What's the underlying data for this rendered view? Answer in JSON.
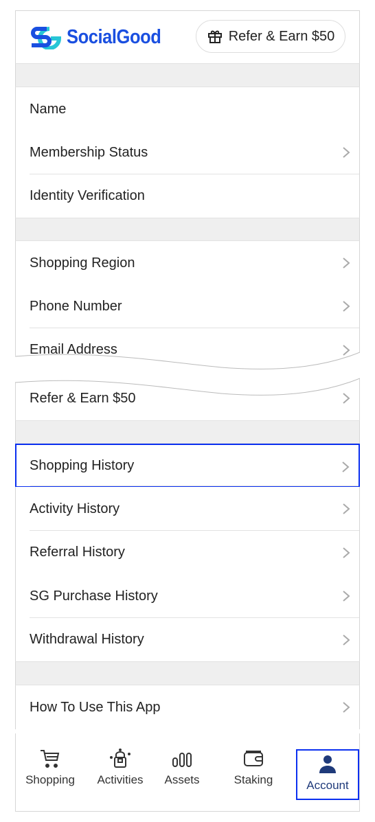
{
  "header": {
    "brand": "SocialGood",
    "refer_button": "Refer & Earn $50"
  },
  "sections": [
    {
      "rows": [
        {
          "label": "Name",
          "chevron": false
        },
        {
          "label": "Membership Status",
          "chevron": true
        },
        {
          "label": "Identity Verification",
          "chevron": false
        }
      ]
    },
    {
      "rows": [
        {
          "label": "Shopping Region",
          "chevron": true
        },
        {
          "label": "Phone Number",
          "chevron": true
        },
        {
          "label": "Email Address",
          "chevron": true
        }
      ]
    },
    {
      "rows": [
        {
          "label": "Refer & Earn $50",
          "chevron": true
        }
      ]
    },
    {
      "rows": [
        {
          "label": "Shopping History",
          "chevron": true,
          "highlighted": true
        },
        {
          "label": "Activity History",
          "chevron": true
        },
        {
          "label": "Referral History",
          "chevron": true
        },
        {
          "label": "SG Purchase History",
          "chevron": true
        },
        {
          "label": "Withdrawal History",
          "chevron": true
        }
      ]
    },
    {
      "rows": [
        {
          "label": "How To Use This App",
          "chevron": true
        }
      ]
    }
  ],
  "nav": [
    {
      "label": "Shopping",
      "icon": "cart-icon"
    },
    {
      "label": "Activities",
      "icon": "gift-box-icon"
    },
    {
      "label": "Assets",
      "icon": "bars-icon"
    },
    {
      "label": "Staking",
      "icon": "wallet-icon"
    },
    {
      "label": "Account",
      "icon": "person-icon",
      "active": true
    }
  ],
  "colors": {
    "brand": "#1a4fe0",
    "brand_teal": "#27c6d6",
    "highlight": "#0a2ff0",
    "active_tab": "#1f3a7a"
  }
}
